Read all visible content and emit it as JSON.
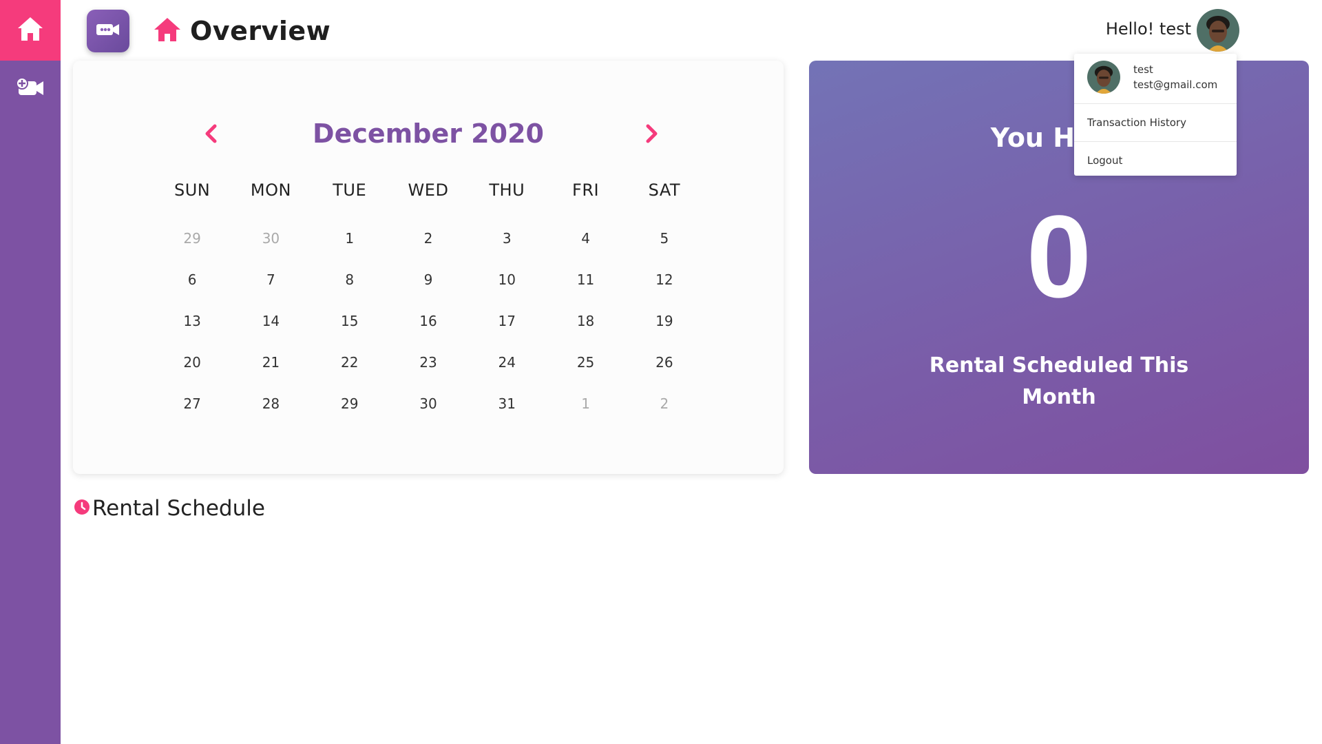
{
  "colors": {
    "accent": "#f53b7c",
    "brand": "#7d52a3"
  },
  "sidebar": {
    "items": [
      {
        "icon": "home-icon"
      },
      {
        "icon": "add-video-camera-icon"
      }
    ]
  },
  "header": {
    "logo_icon": "video-camera-icon",
    "title_icon": "home-icon",
    "title": "Overview",
    "greeting": "Hello! test"
  },
  "user_menu": {
    "name": "test",
    "email": "test@gmail.com",
    "items": [
      "Transaction History",
      "Logout"
    ]
  },
  "calendar": {
    "month_title": "December 2020",
    "weekdays": [
      "SUN",
      "MON",
      "TUE",
      "WED",
      "THU",
      "FRI",
      "SAT"
    ],
    "weeks": [
      [
        "29",
        "30",
        "1",
        "2",
        "3",
        "4",
        "5"
      ],
      [
        "6",
        "7",
        "8",
        "9",
        "10",
        "11",
        "12"
      ],
      [
        "13",
        "14",
        "15",
        "16",
        "17",
        "18",
        "19"
      ],
      [
        "20",
        "21",
        "22",
        "23",
        "24",
        "25",
        "26"
      ],
      [
        "27",
        "28",
        "29",
        "30",
        "31",
        "1",
        "2"
      ]
    ],
    "outside_month": [
      [
        true,
        true,
        false,
        false,
        false,
        false,
        false
      ],
      [
        false,
        false,
        false,
        false,
        false,
        false,
        false
      ],
      [
        false,
        false,
        false,
        false,
        false,
        false,
        false
      ],
      [
        false,
        false,
        false,
        false,
        false,
        false,
        false
      ],
      [
        false,
        false,
        false,
        false,
        false,
        true,
        true
      ]
    ]
  },
  "stats": {
    "lead": "You Have",
    "count": "0",
    "caption": "Rental Scheduled This Month"
  },
  "rental_schedule": {
    "icon": "clock-icon",
    "title": "Rental Schedule"
  }
}
